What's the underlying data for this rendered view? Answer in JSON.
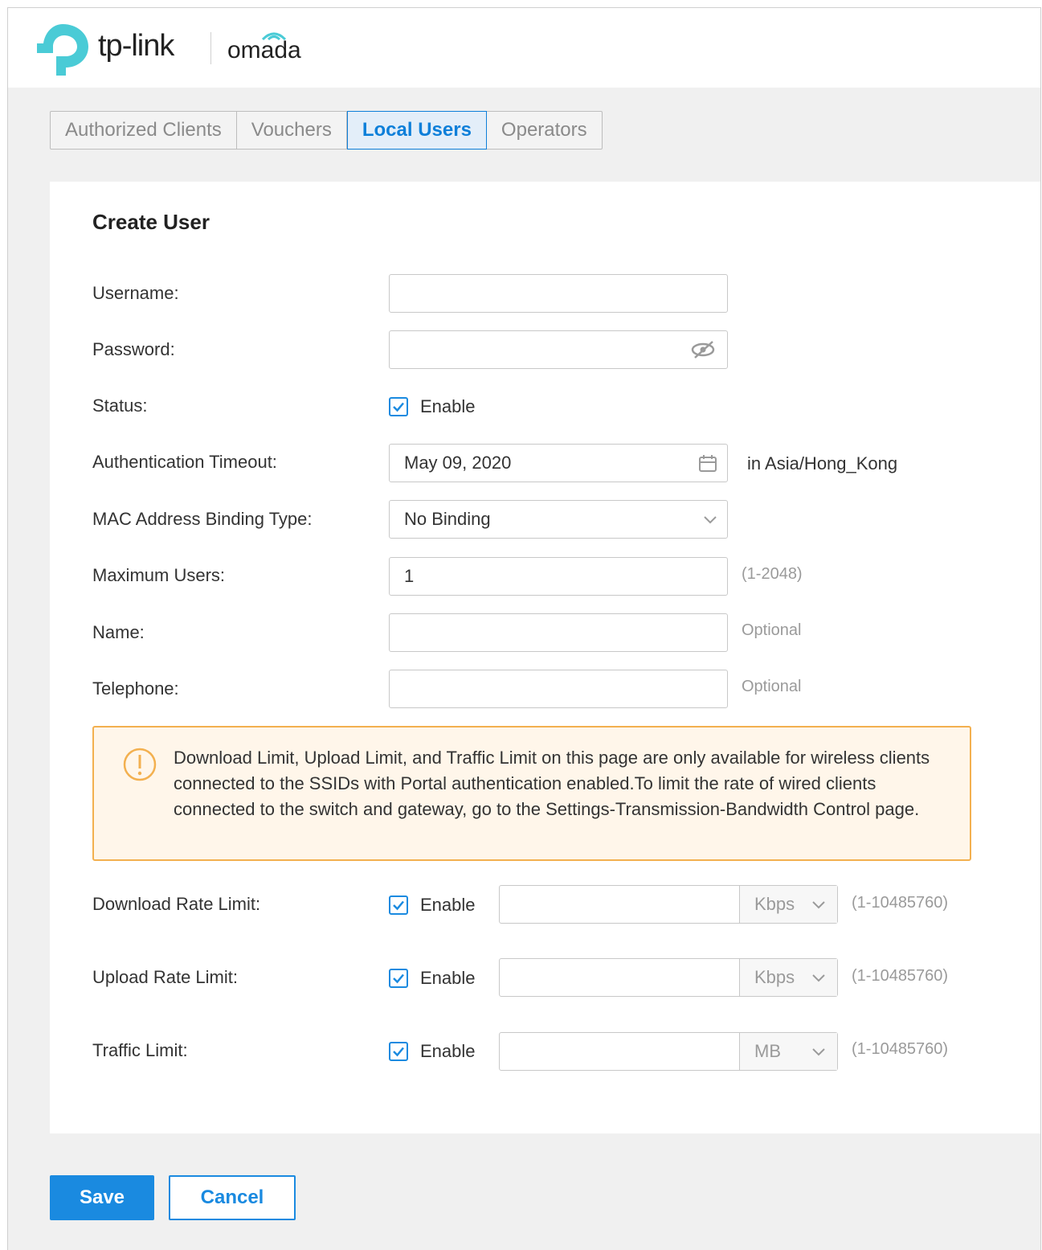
{
  "header": {
    "brand": "tp-link",
    "product": "omada"
  },
  "tabs": [
    {
      "label": "Authorized Clients",
      "active": false
    },
    {
      "label": "Vouchers",
      "active": false
    },
    {
      "label": "Local Users",
      "active": true
    },
    {
      "label": "Operators",
      "active": false
    }
  ],
  "form": {
    "title": "Create User",
    "username": {
      "label": "Username:",
      "value": ""
    },
    "password": {
      "label": "Password:",
      "value": ""
    },
    "status": {
      "label": "Status:",
      "checkbox_label": "Enable",
      "checked": true
    },
    "auth_timeout": {
      "label": "Authentication Timeout:",
      "value": "May 09, 2020",
      "timezone": "in Asia/Hong_Kong"
    },
    "mac_binding": {
      "label": "MAC Address Binding Type:",
      "value": "No Binding"
    },
    "max_users": {
      "label": "Maximum Users:",
      "value": "1",
      "hint": "(1-2048)"
    },
    "name": {
      "label": "Name:",
      "value": "",
      "hint": "Optional"
    },
    "telephone": {
      "label": "Telephone:",
      "value": "",
      "hint": "Optional"
    },
    "notice": "Download Limit, Upload Limit, and Traffic Limit on this page are only available for wireless clients connected to the SSIDs with Portal authentication enabled.To limit the rate of wired clients connected to the switch and gateway, go to the Settings-Transmission-Bandwidth Control page.",
    "download_limit": {
      "label": "Download Rate Limit:",
      "checkbox_label": "Enable",
      "checked": true,
      "value": "",
      "unit": "Kbps",
      "hint": "(1-10485760)"
    },
    "upload_limit": {
      "label": "Upload Rate Limit:",
      "checkbox_label": "Enable",
      "checked": true,
      "value": "",
      "unit": "Kbps",
      "hint": "(1-10485760)"
    },
    "traffic_limit": {
      "label": "Traffic Limit:",
      "checkbox_label": "Enable",
      "checked": true,
      "value": "",
      "unit": "MB",
      "hint": "(1-10485760)"
    }
  },
  "buttons": {
    "save": "Save",
    "cancel": "Cancel"
  },
  "colors": {
    "accent": "#1a8ae0",
    "brand_teal": "#4acbd6",
    "warning_border": "#f3b04f",
    "warning_bg": "#fff6ea"
  }
}
